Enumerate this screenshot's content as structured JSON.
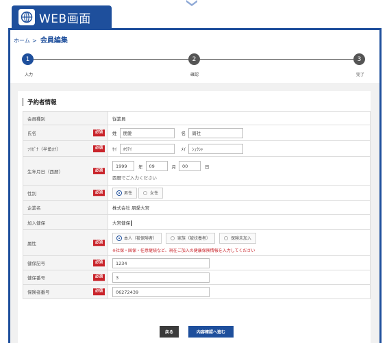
{
  "window": {
    "tab_label": "WEB画面"
  },
  "breadcrumb": {
    "home": "ホーム",
    "separator": ">",
    "current": "会員編集"
  },
  "steps": [
    {
      "number": "1",
      "label": "入力",
      "active": true
    },
    {
      "number": "2",
      "label": "確認",
      "active": false
    },
    {
      "number": "3",
      "label": "完了",
      "active": false
    }
  ],
  "section": {
    "title": "予約者情報"
  },
  "form": {
    "member_type": {
      "label": "会員種別",
      "value": "従業員"
    },
    "name": {
      "label": "氏名",
      "required": "必須",
      "sei_label": "姓",
      "sei_value": "朋愛",
      "mei_label": "名",
      "mei_value": "周社"
    },
    "kana": {
      "label": "ﾌﾘｶﾞﾅ（半角ｶﾅ）",
      "required": "必須",
      "sei_label": "ｾｲ",
      "sei_value": "ﾎｳｱｲ",
      "mei_label": "ﾒｲ",
      "mei_value": "ｼｭｳｼｬ"
    },
    "birthdate": {
      "label": "生年月日（西暦）",
      "required": "必須",
      "year": "1999",
      "year_unit": "年",
      "month": "09",
      "month_unit": "月",
      "day": "00",
      "day_unit": "日",
      "hint": "西暦でご入力ください"
    },
    "gender": {
      "label": "性別",
      "required": "必須",
      "options": [
        "男性",
        "女性"
      ],
      "selected": "男性"
    },
    "company": {
      "label": "企業名",
      "value": "株式会社 朋愛大宮"
    },
    "insurance": {
      "label": "加入健保",
      "value": "大宮健保"
    },
    "relation": {
      "label": "属性",
      "required": "必須",
      "options": [
        "本人（被保険者）",
        "家族（被扶養者）",
        "保険未加入"
      ],
      "selected": "本人（被保険者）",
      "note": "※社保・国保・任意継続など、現在ご加入の健康保険情報を入力してください"
    },
    "insurance_symbol": {
      "label": "健保記号",
      "required": "必須",
      "value": "1234"
    },
    "insurance_number": {
      "label": "健保番号",
      "required": "必須",
      "value": "3"
    },
    "insurer_number": {
      "label": "保険者番号",
      "required": "必須",
      "value": "06272439"
    }
  },
  "buttons": {
    "back": "戻る",
    "confirm": "内容確認へ進む"
  },
  "colors": {
    "primary": "#1e4f9c",
    "required_badge": "#c9242b",
    "step_inactive": "#555555"
  }
}
